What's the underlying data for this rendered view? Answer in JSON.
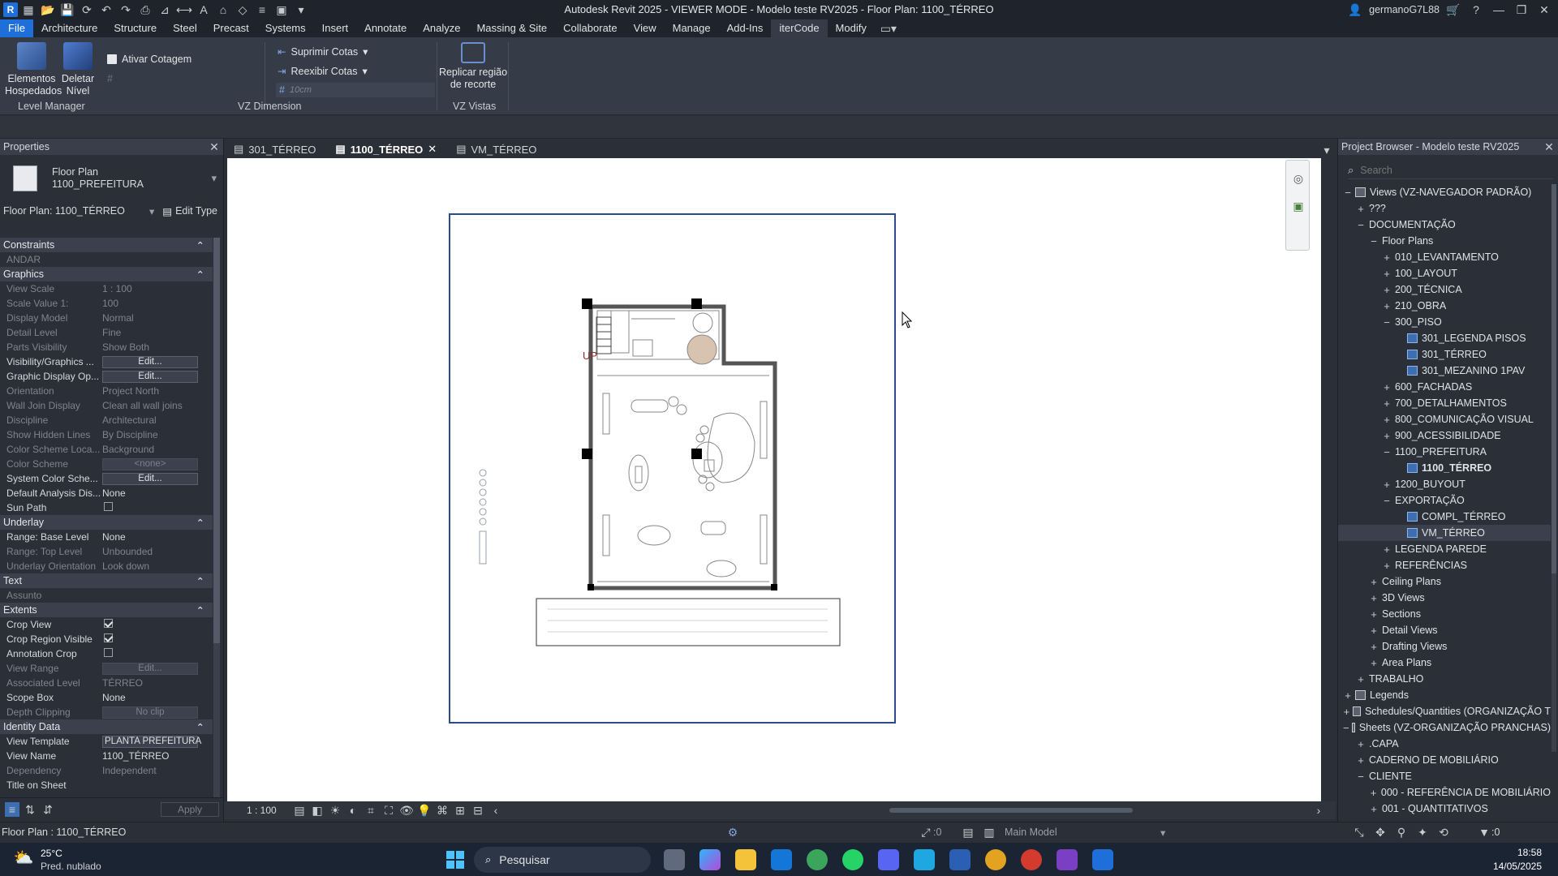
{
  "titlebar": {
    "title": "Autodesk Revit 2025 - VIEWER MODE - Modelo teste RV2025 - Floor Plan: 1100_TÉRREO",
    "user": "germanoG7L88"
  },
  "menu": [
    "File",
    "Architecture",
    "Structure",
    "Steel",
    "Precast",
    "Systems",
    "Insert",
    "Annotate",
    "Analyze",
    "Massing & Site",
    "Collaborate",
    "View",
    "Manage",
    "Add-Ins",
    "iterCode",
    "Modify"
  ],
  "ribbon": {
    "elementos": "Elementos Hospedados",
    "deletar": "Deletar Nível",
    "ativar": "Ativar Cotagem",
    "level_manager": "Level Manager",
    "suprimir": "Suprimir Cotas",
    "reexibir": "Reexibir Cotas",
    "offset": "10cm",
    "vz_dimension": "VZ Dimension",
    "replicar": "Replicar região de recorte",
    "vz_vistas": "VZ Vistas"
  },
  "properties": {
    "header": "Properties",
    "type_line1": "Floor Plan",
    "type_line2": "1100_PREFEITURA",
    "selector": "Floor Plan: 1100_TÉRREO",
    "edit_type": "Edit Type",
    "apply": "Apply",
    "edit": "Edit...",
    "sections": {
      "constraints": "Constraints",
      "graphics": "Graphics",
      "underlay": "Underlay",
      "text": "Text",
      "extents": "Extents",
      "identity": "Identity Data"
    },
    "constraints_rows": [
      {
        "k": "ANDAR",
        "v": ""
      }
    ],
    "graphics_rows": [
      {
        "k": "View Scale",
        "v": "1 : 100"
      },
      {
        "k": "Scale Value    1:",
        "v": "100"
      },
      {
        "k": "Display Model",
        "v": "Normal"
      },
      {
        "k": "Detail Level",
        "v": "Fine"
      },
      {
        "k": "Parts Visibility",
        "v": "Show Both"
      }
    ],
    "vis_graphics": "Visibility/Graphics ...",
    "graphic_display": "Graphic Display Op...",
    "graphics_rows2": [
      {
        "k": "Orientation",
        "v": "Project North"
      },
      {
        "k": "Wall Join Display",
        "v": "Clean all wall joins"
      },
      {
        "k": "Discipline",
        "v": "Architectural"
      },
      {
        "k": "Show Hidden Lines",
        "v": "By Discipline"
      },
      {
        "k": "Color Scheme Loca...",
        "v": "Background"
      }
    ],
    "color_scheme": "Color Scheme",
    "color_scheme_val": "<none>",
    "system_color": "System Color Sche...",
    "default_analysis": "Default Analysis Dis...",
    "default_analysis_val": "None",
    "sun_path": "Sun Path",
    "underlay_rows": [
      {
        "k": "Range: Base Level",
        "v": "None",
        "dim": false
      },
      {
        "k": "Range: Top Level",
        "v": "Unbounded",
        "dim": true
      },
      {
        "k": "Underlay Orientation",
        "v": "Look down",
        "dim": true
      }
    ],
    "text_rows": [
      {
        "k": "Assunto",
        "v": ""
      }
    ],
    "crop_view": "Crop View",
    "crop_region": "Crop Region Visible",
    "annotation_crop": "Annotation Crop",
    "view_range": "View Range",
    "assoc_level": "Associated Level",
    "assoc_level_val": "TÉRREO",
    "scope_box": "Scope Box",
    "scope_box_val": "None",
    "depth_clipping": "Depth Clipping",
    "depth_clipping_val": "No clip",
    "view_template": "View Template",
    "view_template_val": "PLANTA PREFEITURA",
    "view_name": "View Name",
    "view_name_val": "1100_TÉRREO",
    "dependency": "Dependency",
    "dependency_val": "Independent",
    "title_on_sheet": "Title on Sheet"
  },
  "tabs": [
    "301_TÉRREO",
    "1100_TÉRREO",
    "VM_TÉRREO"
  ],
  "canvas": {
    "up_label": "UP"
  },
  "viewbar": {
    "scale": "1 : 100"
  },
  "browser": {
    "header": "Project Browser - Modelo teste RV2025",
    "search_placeholder": "Search",
    "items": [
      {
        "t": "Views (VZ-NAVEGADOR PADRÃO)",
        "l": 0,
        "g": "−",
        "i": true
      },
      {
        "t": "???",
        "l": 1,
        "g": "+"
      },
      {
        "t": "DOCUMENTAÇÃO",
        "l": 1,
        "g": "−"
      },
      {
        "t": "Floor Plans",
        "l": 2,
        "g": "−"
      },
      {
        "t": "010_LEVANTAMENTO",
        "l": 3,
        "g": "+"
      },
      {
        "t": "100_LAYOUT",
        "l": 3,
        "g": "+"
      },
      {
        "t": "200_TÉCNICA",
        "l": 3,
        "g": "+"
      },
      {
        "t": "210_OBRA",
        "l": 3,
        "g": "+"
      },
      {
        "t": "300_PISO",
        "l": 3,
        "g": "−"
      },
      {
        "t": "301_LEGENDA PISOS",
        "l": 4,
        "g": "",
        "v": true
      },
      {
        "t": "301_TÉRREO",
        "l": 4,
        "g": "",
        "v": true
      },
      {
        "t": "301_MEZANINO 1PAV",
        "l": 4,
        "g": "",
        "v": true
      },
      {
        "t": "600_FACHADAS",
        "l": 3,
        "g": "+"
      },
      {
        "t": "700_DETALHAMENTOS",
        "l": 3,
        "g": "+"
      },
      {
        "t": "800_COMUNICAÇÃO VISUAL",
        "l": 3,
        "g": "+"
      },
      {
        "t": "900_ACESSIBILIDADE",
        "l": 3,
        "g": "+"
      },
      {
        "t": "1100_PREFEITURA",
        "l": 3,
        "g": "−"
      },
      {
        "t": "1100_TÉRREO",
        "l": 4,
        "g": "",
        "v": true,
        "b": true
      },
      {
        "t": "1200_BUYOUT",
        "l": 3,
        "g": "+"
      },
      {
        "t": "EXPORTAÇÃO",
        "l": 3,
        "g": "−"
      },
      {
        "t": "COMPL_TÉRREO",
        "l": 4,
        "g": "",
        "v": true
      },
      {
        "t": "VM_TÉRREO",
        "l": 4,
        "g": "",
        "v": true,
        "s": true
      },
      {
        "t": "LEGENDA PAREDE",
        "l": 3,
        "g": "+"
      },
      {
        "t": "REFERÊNCIAS",
        "l": 3,
        "g": "+"
      },
      {
        "t": "Ceiling Plans",
        "l": 2,
        "g": "+"
      },
      {
        "t": "3D Views",
        "l": 2,
        "g": "+"
      },
      {
        "t": "Sections",
        "l": 2,
        "g": "+"
      },
      {
        "t": "Detail Views",
        "l": 2,
        "g": "+"
      },
      {
        "t": "Drafting Views",
        "l": 2,
        "g": "+"
      },
      {
        "t": "Area Plans",
        "l": 2,
        "g": "+"
      },
      {
        "t": "TRABALHO",
        "l": 1,
        "g": "+"
      },
      {
        "t": "Legends",
        "l": 0,
        "g": "+",
        "i": true
      },
      {
        "t": "Schedules/Quantities (ORGANIZAÇÃO T",
        "l": 0,
        "g": "+",
        "i": true
      },
      {
        "t": "Sheets (VZ-ORGANIZAÇÃO PRANCHAS)",
        "l": 0,
        "g": "−",
        "i": true
      },
      {
        "t": ".CAPA",
        "l": 1,
        "g": "+"
      },
      {
        "t": "CADERNO DE MOBILIÁRIO",
        "l": 1,
        "g": "+"
      },
      {
        "t": "CLIENTE",
        "l": 1,
        "g": "−"
      },
      {
        "t": "000 - REFERÊNCIA DE MOBILIÁRIO",
        "l": 2,
        "g": "+"
      },
      {
        "t": "001 - QUANTITATIVOS",
        "l": 2,
        "g": "+"
      }
    ]
  },
  "status": {
    "left": "Floor Plan : 1100_TÉRREO",
    "zero": ":0",
    "model": "Main Model",
    "filter": ":0"
  },
  "taskbar": {
    "temp": "25°C",
    "weather": "Pred. nublado",
    "search": "Pesquisar",
    "time": "18:58",
    "date": "14/05/2025"
  }
}
